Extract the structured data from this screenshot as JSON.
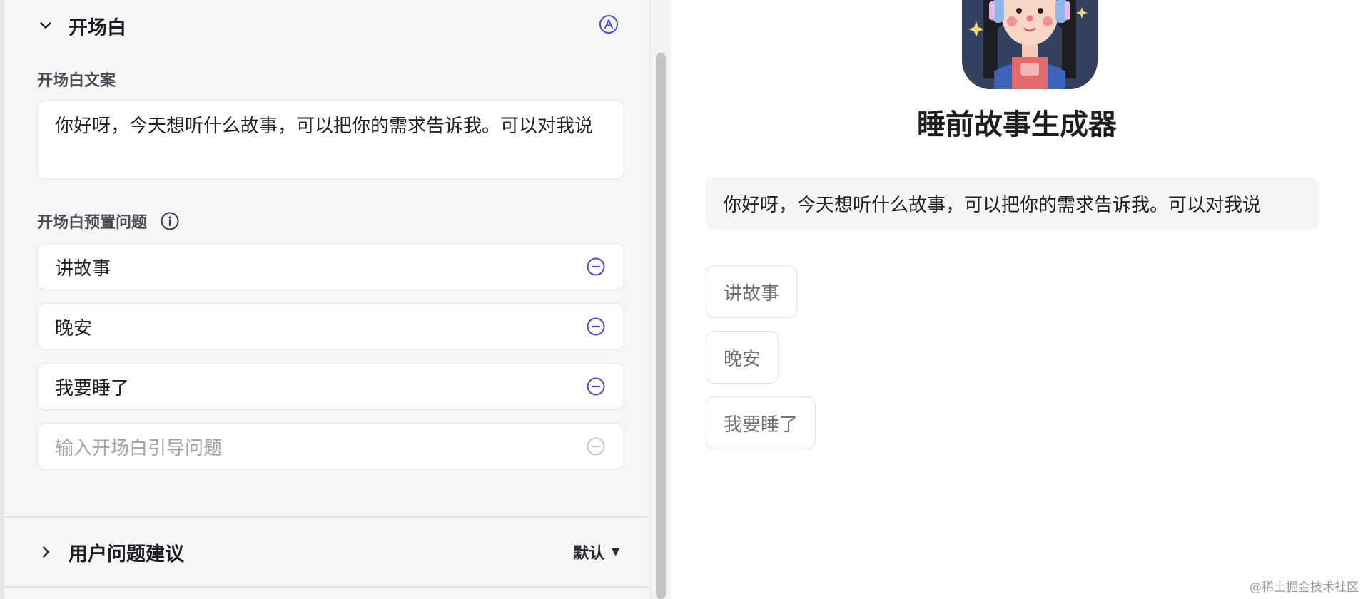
{
  "opening": {
    "title": "开场白",
    "copy_label": "开场白文案",
    "copy_text": "你好呀，今天想听什么故事，可以把你的需求告诉我。可以对我说",
    "preset_label": "开场白预置问题",
    "questions": [
      "讲故事",
      "晚安",
      "我要睡了"
    ],
    "question_placeholder": "输入开场白引导问题"
  },
  "suggestions": {
    "title": "用户问题建议",
    "mode": "默认"
  },
  "preview": {
    "bot_name": "睡前故事生成器",
    "greeting": "你好呀，今天想听什么故事，可以把你的需求告诉我。可以对我说",
    "chips": [
      "讲故事",
      "晚安",
      "我要睡了"
    ]
  },
  "watermark": "@稀土掘金技术社区",
  "colors": {
    "accent": "#4b4fc4",
    "panel_bg": "#f6f6f8",
    "border": "#e4e4e8"
  },
  "icons": {
    "collapse": "chevron-down-icon",
    "expand": "chevron-right-icon",
    "auto": "auto-a-icon",
    "info": "info-icon",
    "remove": "minus-circle-icon"
  }
}
